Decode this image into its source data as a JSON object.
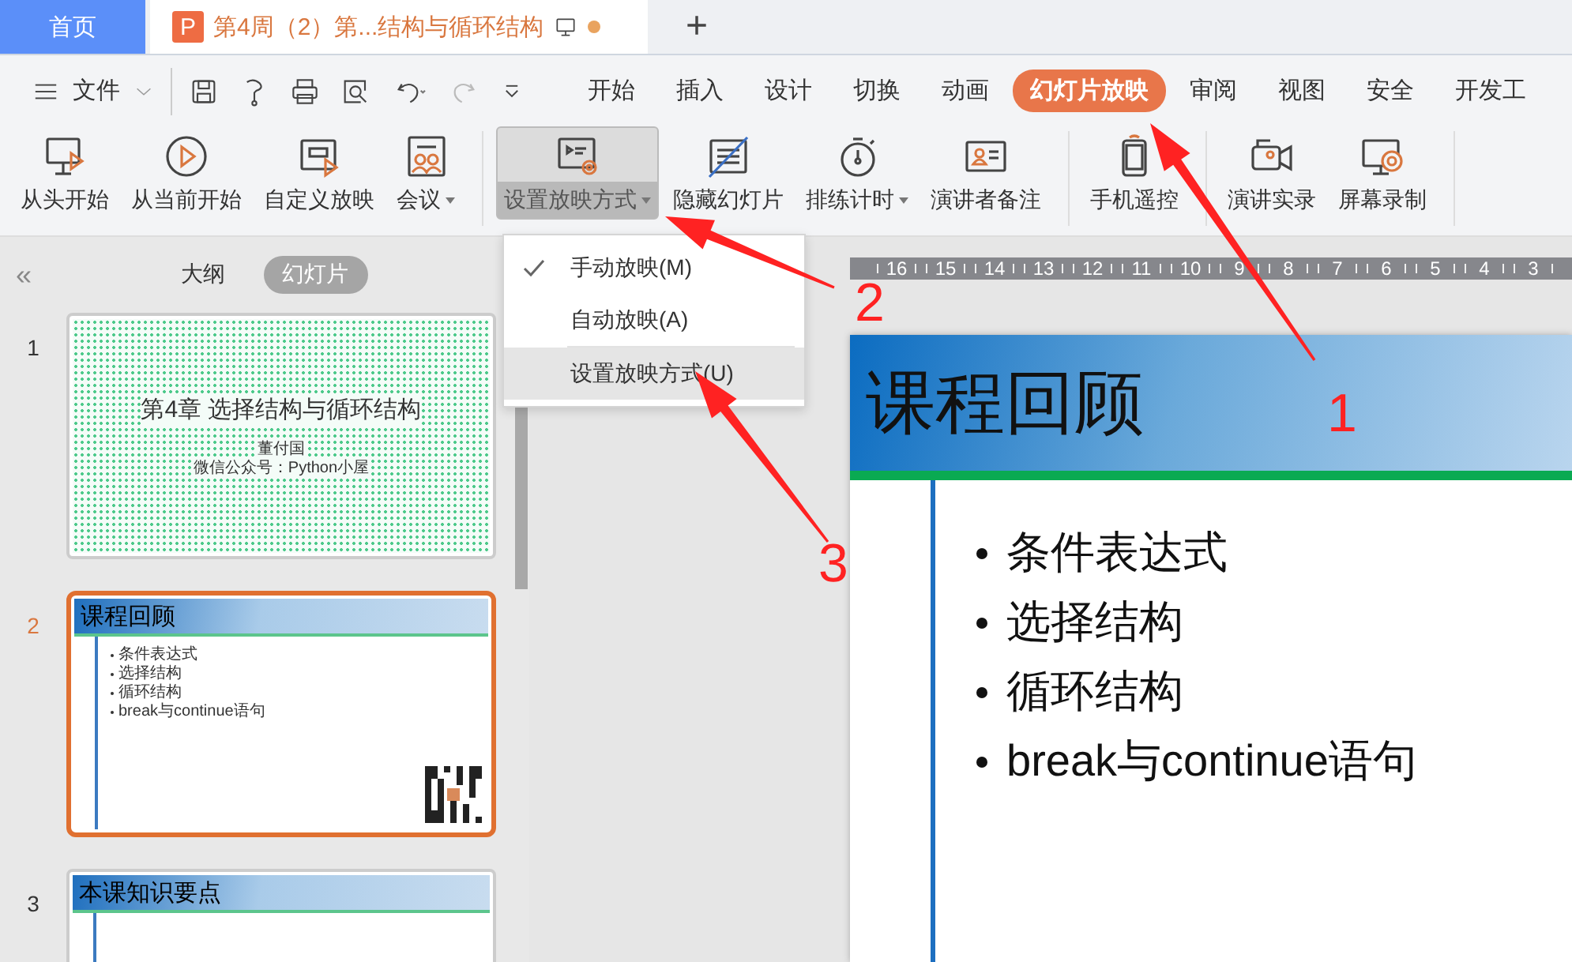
{
  "tabs": [
    {
      "label": "首页",
      "kind": "home",
      "selected": false
    },
    {
      "label": "第4周（2）第...结构与循环结构",
      "kind": "document",
      "selected": true,
      "badge": "P",
      "unsaved": true
    }
  ],
  "new_tab": "+",
  "file_menu": {
    "label": "文件"
  },
  "ribbon_tabs": [
    {
      "label": "开始",
      "selected": false
    },
    {
      "label": "插入",
      "selected": false
    },
    {
      "label": "设计",
      "selected": false
    },
    {
      "label": "切换",
      "selected": false
    },
    {
      "label": "动画",
      "selected": false
    },
    {
      "label": "幻灯片放映",
      "selected": true
    },
    {
      "label": "审阅",
      "selected": false
    },
    {
      "label": "视图",
      "selected": false
    },
    {
      "label": "安全",
      "selected": false
    },
    {
      "label": "开发工",
      "selected": false
    }
  ],
  "ribbon_groups": [
    [
      {
        "label": "从头开始",
        "dropdown": false,
        "pressed": false
      },
      {
        "label": "从当前开始",
        "dropdown": false,
        "pressed": false
      },
      {
        "label": "自定义放映",
        "dropdown": false,
        "pressed": false
      },
      {
        "label": "会议",
        "dropdown": true,
        "pressed": false
      }
    ],
    [
      {
        "label": "设置放映方式",
        "dropdown": true,
        "pressed": true
      },
      {
        "label": "隐藏幻灯片",
        "dropdown": false,
        "pressed": false
      },
      {
        "label": "排练计时",
        "dropdown": true,
        "pressed": false
      },
      {
        "label": "演讲者备注",
        "dropdown": false,
        "pressed": false
      }
    ],
    [
      {
        "label": "手机遥控",
        "dropdown": false,
        "pressed": false
      }
    ],
    [
      {
        "label": "演讲实录",
        "dropdown": false,
        "pressed": false
      },
      {
        "label": "屏幕录制",
        "dropdown": false,
        "pressed": false
      }
    ]
  ],
  "dropdown_menu": [
    {
      "kind": "item",
      "label": "手动放映(M)",
      "checked": true,
      "selected": false
    },
    {
      "kind": "item",
      "label": "自动放映(A)",
      "checked": false,
      "selected": false
    },
    {
      "kind": "separator"
    },
    {
      "kind": "item",
      "label": "设置放映方式(U)",
      "checked": false,
      "selected": true
    }
  ],
  "collapse": "«",
  "pane_tabs": [
    {
      "label": "大纲",
      "selected": false
    },
    {
      "label": "幻灯片",
      "selected": true
    }
  ],
  "slides": [
    {
      "number": "1",
      "kind": "title",
      "selected": false,
      "title": "第4章  选择结构与循环结构",
      "lines": [
        "董付国",
        "微信公众号：Python小屋"
      ]
    },
    {
      "number": "2",
      "kind": "content",
      "selected": true,
      "title": "课程回顾",
      "bullets": [
        "条件表达式",
        "选择结构",
        "循环结构",
        "break与continue语句"
      ],
      "qr_code": true
    },
    {
      "number": "3",
      "kind": "content",
      "selected": false,
      "title": "本课知识要点"
    }
  ],
  "ruler": [
    "16",
    "15",
    "14",
    "13",
    "12",
    "11",
    "10",
    "9",
    "8",
    "7",
    "6",
    "5",
    "4",
    "3"
  ],
  "slide": {
    "title": "课程回顾",
    "bullets": [
      "条件表达式",
      "选择结构",
      "循环结构",
      "break与continue语句"
    ]
  },
  "annotations": [
    {
      "label": "1"
    },
    {
      "label": "2"
    },
    {
      "label": "3"
    }
  ]
}
